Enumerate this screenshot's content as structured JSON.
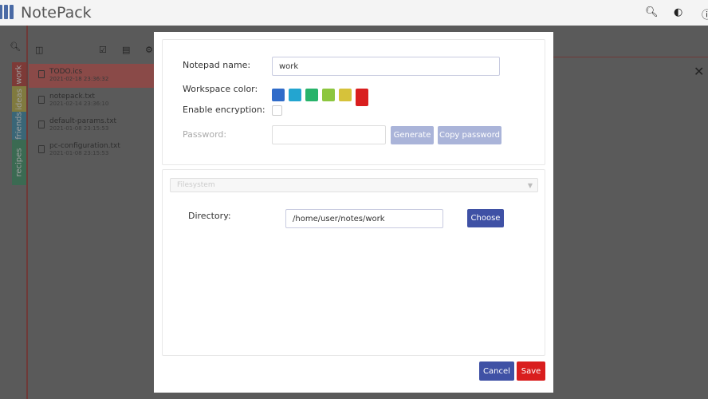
{
  "header": {
    "title": "NotePack",
    "icons": [
      "search-icon",
      "theme-toggle-icon",
      "info-icon"
    ]
  },
  "sidebar": {
    "tabs": [
      {
        "label": "work",
        "color": "#c0392b"
      },
      {
        "label": "ideas",
        "color": "#c9b43a"
      },
      {
        "label": "friends",
        "color": "#2e86ab"
      },
      {
        "label": "recipes",
        "color": "#2e9c6a"
      }
    ]
  },
  "files": [
    {
      "name": "TODO.ics",
      "time": "2021-02-18 23:36:32"
    },
    {
      "name": "notepack.txt",
      "time": "2021-02-14 23:36:10"
    },
    {
      "name": "default-params.txt",
      "time": "2021-01-08 23:15:53"
    },
    {
      "name": "pc-configuration.txt",
      "time": "2021-01-08 23:15:53"
    }
  ],
  "dialog": {
    "name_label": "Notepad name:",
    "name_value": "work",
    "color_label": "Workspace color:",
    "colors": [
      "#2f6bc9",
      "#23a5d0",
      "#27b36a",
      "#8cc63f",
      "#d6c23a",
      "#d91e1e"
    ],
    "selected_color": "#d91e1e",
    "encryption_label": "Enable encryption:",
    "encryption_enabled": false,
    "password_label": "Password:",
    "password_value": "",
    "generate_label": "Generate",
    "copy_label": "Copy password",
    "storage_select": "Filesystem",
    "directory_label": "Directory:",
    "directory_value": "/home/user/notes/work",
    "choose_label": "Choose",
    "cancel_label": "Cancel",
    "save_label": "Save"
  }
}
